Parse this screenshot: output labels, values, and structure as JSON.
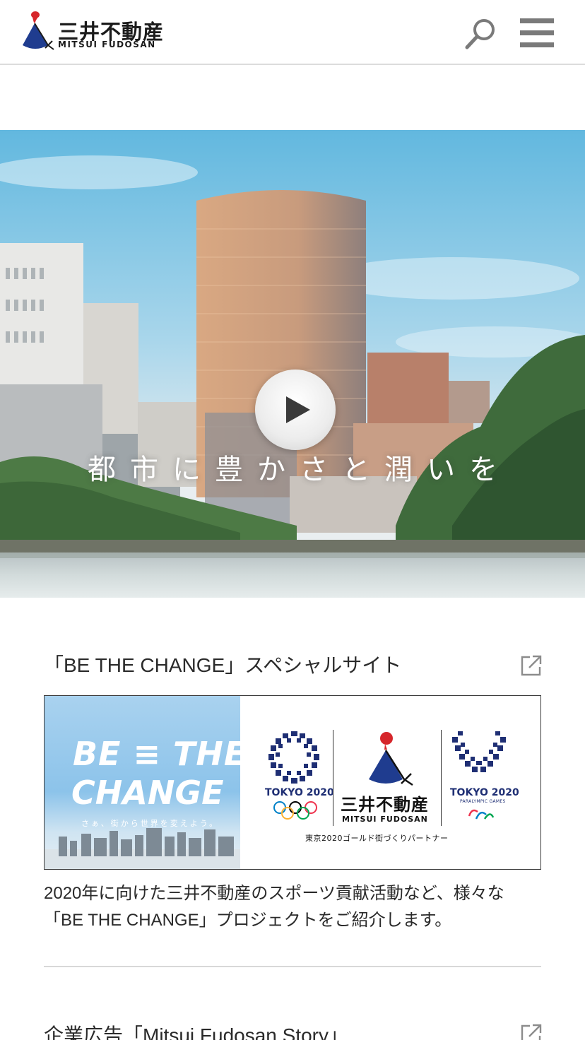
{
  "header": {
    "logo_jp": "三井不動産",
    "logo_en": "MITSUI FUDOSAN",
    "search_icon": "search-icon",
    "menu_icon": "hamburger-menu-icon"
  },
  "hero": {
    "caption": "都市に豊かさと潤いを",
    "play_icon": "play-icon"
  },
  "section1": {
    "title": "「BE THE CHANGE」スペシャルサイト",
    "external_icon": "external-link-icon",
    "banner": {
      "be_the": "BE ≡ THE",
      "change": "CHANGE",
      "tagline": "さぁ、街から世界を変えよう。",
      "tokyo_olympic": "TOKYO 2020",
      "tokyo_paralympic": "TOKYO 2020",
      "paralympic_games": "PARALYMPIC GAMES",
      "sponsor_jp": "三井不動産",
      "sponsor_en": "MITSUI FUDOSAN",
      "partner": "東京2020ゴールド街づくりパートナー"
    },
    "description": "2020年に向けた三井不動産のスポーツ貢献活動など、様々な「BE THE CHANGE」プロジェクトをご紹介します。"
  },
  "section2": {
    "title": "企業広告「Mitsui Fudosan Story」",
    "external_icon": "external-link-icon"
  },
  "colors": {
    "brand_red": "#d6262b",
    "brand_blue": "#1f3c8f",
    "olympic_navy": "#1f2f74"
  }
}
